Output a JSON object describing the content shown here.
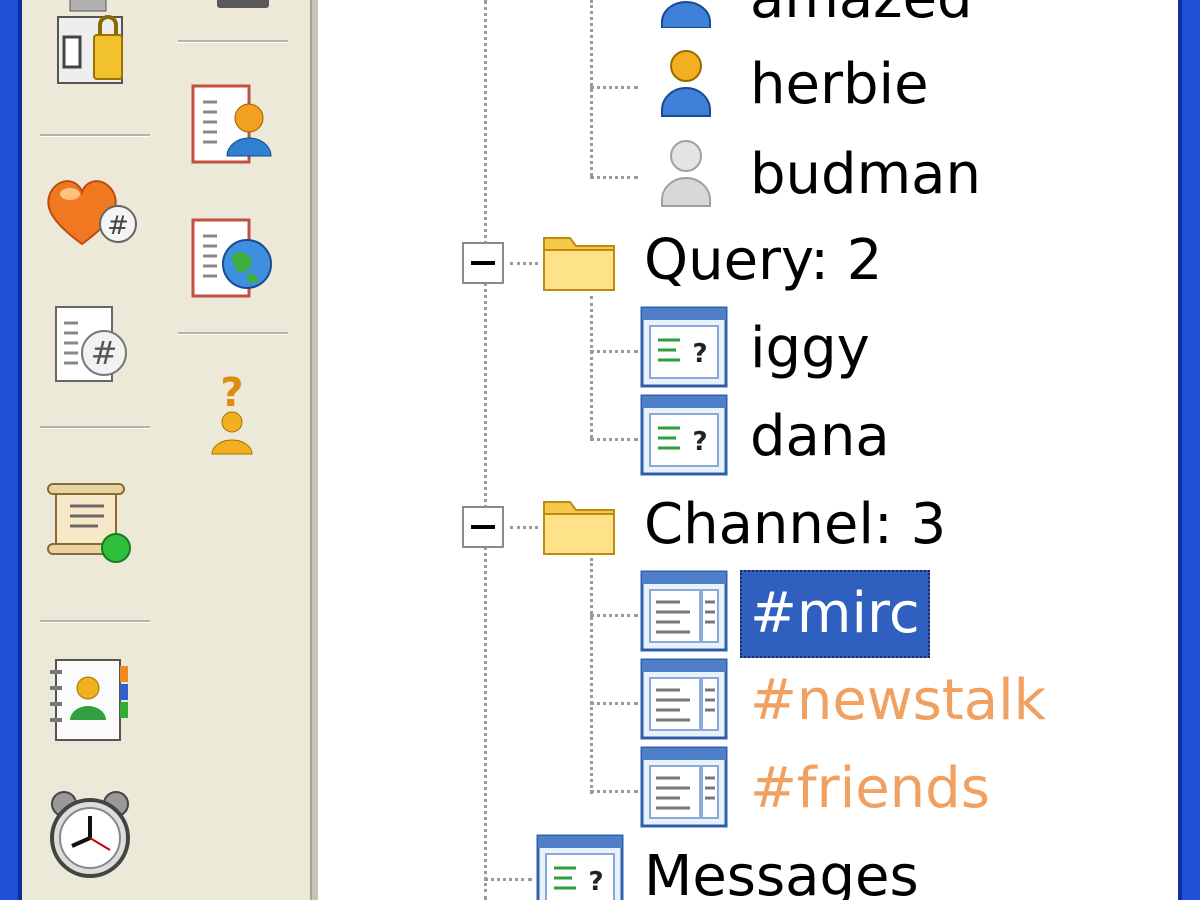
{
  "colors": {
    "selection": "#2f5fbf",
    "activity_text": "#f0a060",
    "toolbar_bg": "#ece9d8",
    "title_blue": "#1f4fd6"
  },
  "toolbar": {
    "column1": [
      {
        "icon": "lock-document-icon"
      },
      {
        "icon": "heart-hash-icon"
      },
      {
        "icon": "document-hash-icon"
      },
      {
        "icon": "scroll-online-icon"
      },
      {
        "icon": "address-book-icon"
      },
      {
        "icon": "alarm-clock-icon"
      }
    ],
    "column2": [
      {
        "icon": "document-user-icon"
      },
      {
        "icon": "document-globe-icon"
      },
      {
        "icon": "help-user-icon"
      }
    ]
  },
  "tree": {
    "users": [
      {
        "name": "amazed",
        "icon": "user-blue-icon"
      },
      {
        "name": "herbie",
        "icon": "user-yellow-icon"
      },
      {
        "name": "budman",
        "icon": "user-grey-icon"
      }
    ],
    "query": {
      "label": "Query: 2",
      "items": [
        {
          "name": "iggy",
          "icon": "query-window-icon"
        },
        {
          "name": "dana",
          "icon": "query-window-icon"
        }
      ]
    },
    "channel": {
      "label": "Channel: 3",
      "items": [
        {
          "name": "#mirc",
          "state": "selected"
        },
        {
          "name": "#newstalk",
          "state": "activity"
        },
        {
          "name": "#friends",
          "state": "activity"
        }
      ]
    },
    "messages": {
      "label": "Messages"
    }
  }
}
